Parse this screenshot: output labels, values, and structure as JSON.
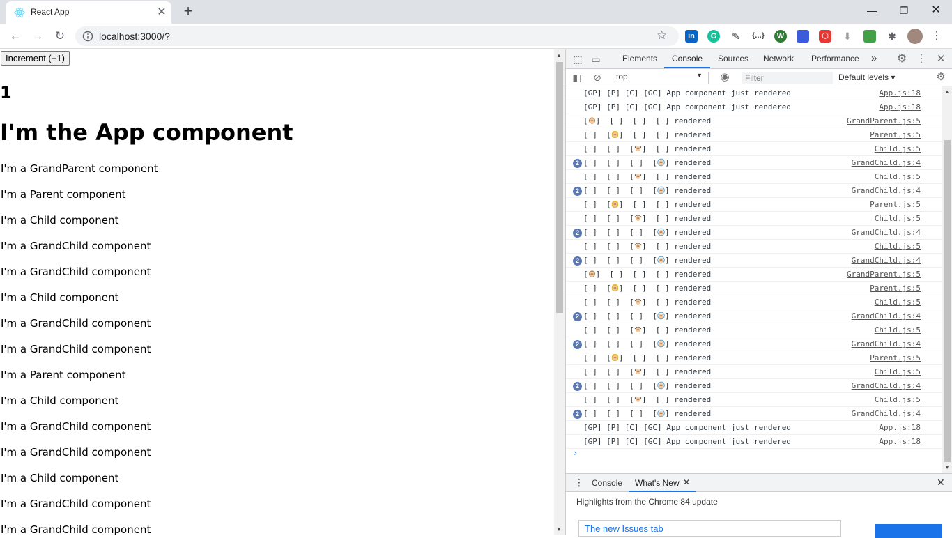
{
  "browser": {
    "tab_title": "React App",
    "url": "localhost:3000/?"
  },
  "page": {
    "increment_label": "Increment (+1)",
    "counter": "1",
    "heading": "I'm the App component",
    "lines": [
      "I'm a GrandParent component",
      "I'm a Parent component",
      "I'm a Child component",
      "I'm a GrandChild component",
      "I'm a GrandChild component",
      "I'm a Child component",
      "I'm a GrandChild component",
      "I'm a GrandChild component",
      "I'm a Parent component",
      "I'm a Child component",
      "I'm a GrandChild component",
      "I'm a GrandChild component",
      "I'm a Child component",
      "I'm a GrandChild component",
      "I'm a GrandChild component"
    ]
  },
  "devtools": {
    "tabs": [
      "Elements",
      "Console",
      "Sources",
      "Network",
      "Performance"
    ],
    "active_tab": "Console",
    "more_tabs": "»",
    "context": "top",
    "filter_placeholder": "Filter",
    "levels": "Default levels ▾",
    "prompt": "›",
    "logs": [
      {
        "kind": "app",
        "badge": "",
        "text": "[GP] [P] [C] [GC] App component just rendered",
        "src": "App.js:18"
      },
      {
        "kind": "app",
        "badge": "",
        "text": "[GP] [P] [C] [GC] App component just rendered",
        "src": "App.js:18"
      },
      {
        "kind": "gp",
        "badge": "",
        "text": "rendered",
        "src": "GrandParent.js:5"
      },
      {
        "kind": "p",
        "badge": "",
        "text": "rendered",
        "src": "Parent.js:5"
      },
      {
        "kind": "c",
        "badge": "",
        "text": "rendered",
        "src": "Child.js:5"
      },
      {
        "kind": "gc",
        "badge": "2",
        "text": "rendered",
        "src": "GrandChild.js:4"
      },
      {
        "kind": "c",
        "badge": "",
        "text": "rendered",
        "src": "Child.js:5"
      },
      {
        "kind": "gc",
        "badge": "2",
        "text": "rendered",
        "src": "GrandChild.js:4"
      },
      {
        "kind": "p",
        "badge": "",
        "text": "rendered",
        "src": "Parent.js:5"
      },
      {
        "kind": "c",
        "badge": "",
        "text": "rendered",
        "src": "Child.js:5"
      },
      {
        "kind": "gc",
        "badge": "2",
        "text": "rendered",
        "src": "GrandChild.js:4"
      },
      {
        "kind": "c",
        "badge": "",
        "text": "rendered",
        "src": "Child.js:5"
      },
      {
        "kind": "gc",
        "badge": "2",
        "text": "rendered",
        "src": "GrandChild.js:4"
      },
      {
        "kind": "gp",
        "badge": "",
        "text": "rendered",
        "src": "GrandParent.js:5"
      },
      {
        "kind": "p",
        "badge": "",
        "text": "rendered",
        "src": "Parent.js:5"
      },
      {
        "kind": "c",
        "badge": "",
        "text": "rendered",
        "src": "Child.js:5"
      },
      {
        "kind": "gc",
        "badge": "2",
        "text": "rendered",
        "src": "GrandChild.js:4"
      },
      {
        "kind": "c",
        "badge": "",
        "text": "rendered",
        "src": "Child.js:5"
      },
      {
        "kind": "gc",
        "badge": "2",
        "text": "rendered",
        "src": "GrandChild.js:4"
      },
      {
        "kind": "p",
        "badge": "",
        "text": "rendered",
        "src": "Parent.js:5"
      },
      {
        "kind": "c",
        "badge": "",
        "text": "rendered",
        "src": "Child.js:5"
      },
      {
        "kind": "gc",
        "badge": "2",
        "text": "rendered",
        "src": "GrandChild.js:4"
      },
      {
        "kind": "c",
        "badge": "",
        "text": "rendered",
        "src": "Child.js:5"
      },
      {
        "kind": "gc",
        "badge": "2",
        "text": "rendered",
        "src": "GrandChild.js:4"
      },
      {
        "kind": "app",
        "badge": "",
        "text": "[GP] [P] [C] [GC] App component just rendered",
        "src": "App.js:18"
      },
      {
        "kind": "app",
        "badge": "",
        "text": "[GP] [P] [C] [GC] App component just rendered",
        "src": "App.js:18"
      }
    ],
    "drawer": {
      "tabs": [
        "Console",
        "What's New"
      ],
      "active": "What's New",
      "highlights": "Highlights from the Chrome 84 update",
      "issues_link": "The new Issues tab"
    }
  },
  "icons": {
    "favicon": "react-icon",
    "extensions": [
      "linkedin-icon",
      "grammarly-icon",
      "eyedropper-icon",
      "json-icon",
      "wordpress-icon",
      "folder-icon",
      "shield-icon",
      "download-icon",
      "image-icon",
      "puzzle-icon"
    ]
  },
  "colors": {
    "accent": "#1a73e8",
    "badge": "#5a78b4",
    "tabstrip": "#dee1e6"
  }
}
